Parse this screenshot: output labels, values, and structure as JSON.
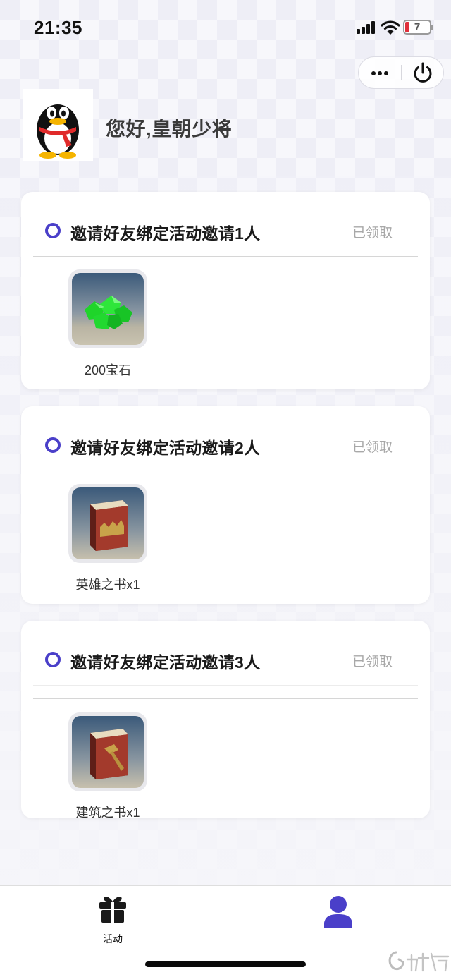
{
  "status_bar": {
    "time": "21:35",
    "battery_level": "7"
  },
  "header": {
    "greeting": "您好,皇朝少将"
  },
  "tasks": [
    {
      "title": "邀请好友绑定活动邀请1人",
      "status": "已领取",
      "reward_label": "200宝石",
      "reward_icon": "green-gems-icon"
    },
    {
      "title": "邀请好友绑定活动邀请2人",
      "status": "已领取",
      "reward_label": "英雄之书x1",
      "reward_icon": "hero-book-icon"
    },
    {
      "title": "邀请好友绑定活动邀请3人",
      "status": "已领取",
      "reward_label": "建筑之书x1",
      "reward_icon": "building-book-icon"
    }
  ],
  "tabbar": {
    "activity_label": "活动"
  },
  "colors": {
    "accent": "#4a3fc9",
    "status_gray": "#a8a8a8",
    "battery_low": "#e0303a"
  }
}
